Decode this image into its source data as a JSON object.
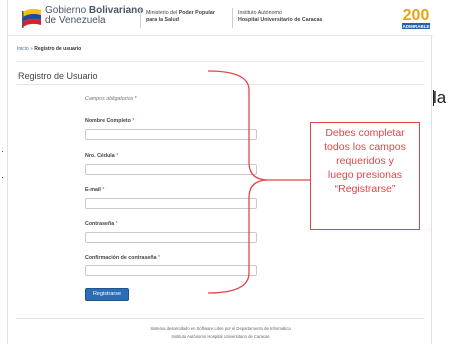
{
  "header": {
    "gov_line1_prefix": "Gobierno",
    "gov_line1_bold": "Bolivariano",
    "gov_line2": "de Venezuela",
    "ministry_line1_prefix": "Ministerio del",
    "ministry_line1_bold": "Poder Popular",
    "ministry_line2": "para la Salud",
    "institute_line1": "Instituto Autónomo",
    "institute_line2": "Hospital Universitario de Caracas",
    "logo_number": "200",
    "logo_word": "ADMIRABLE"
  },
  "breadcrumb": {
    "home": "Inicio",
    "separator": "»",
    "current": "Registro de usuario"
  },
  "page": {
    "title": "Registro de Usuario"
  },
  "form": {
    "required_note": "Campos obligatorios",
    "required_mark": "*",
    "fields": [
      {
        "label": "Nombre Completo",
        "value": ""
      },
      {
        "label": "Nro. Cédula",
        "value": ""
      },
      {
        "label": "E-mail",
        "value": ""
      },
      {
        "label": "Contraseña",
        "value": ""
      },
      {
        "label": "Confirmación de contraseña",
        "value": ""
      }
    ],
    "submit_label": "Registrarse"
  },
  "footer": {
    "line1": "Sistema desarrollado en Software Libre por el Departamento de Informática",
    "line2": "Instituto Autónomo Hospital Universitario de Caracas"
  },
  "annotation": {
    "lines": [
      "Debes completar",
      "todos los campos",
      "requeridos y",
      "luego presionas",
      "“Registrarse”"
    ],
    "clipped_text": "la",
    "color": "#e1464a"
  },
  "colors": {
    "button": "#2d6db4",
    "required_star": "#d9383a",
    "link": "#3a6ea5"
  }
}
